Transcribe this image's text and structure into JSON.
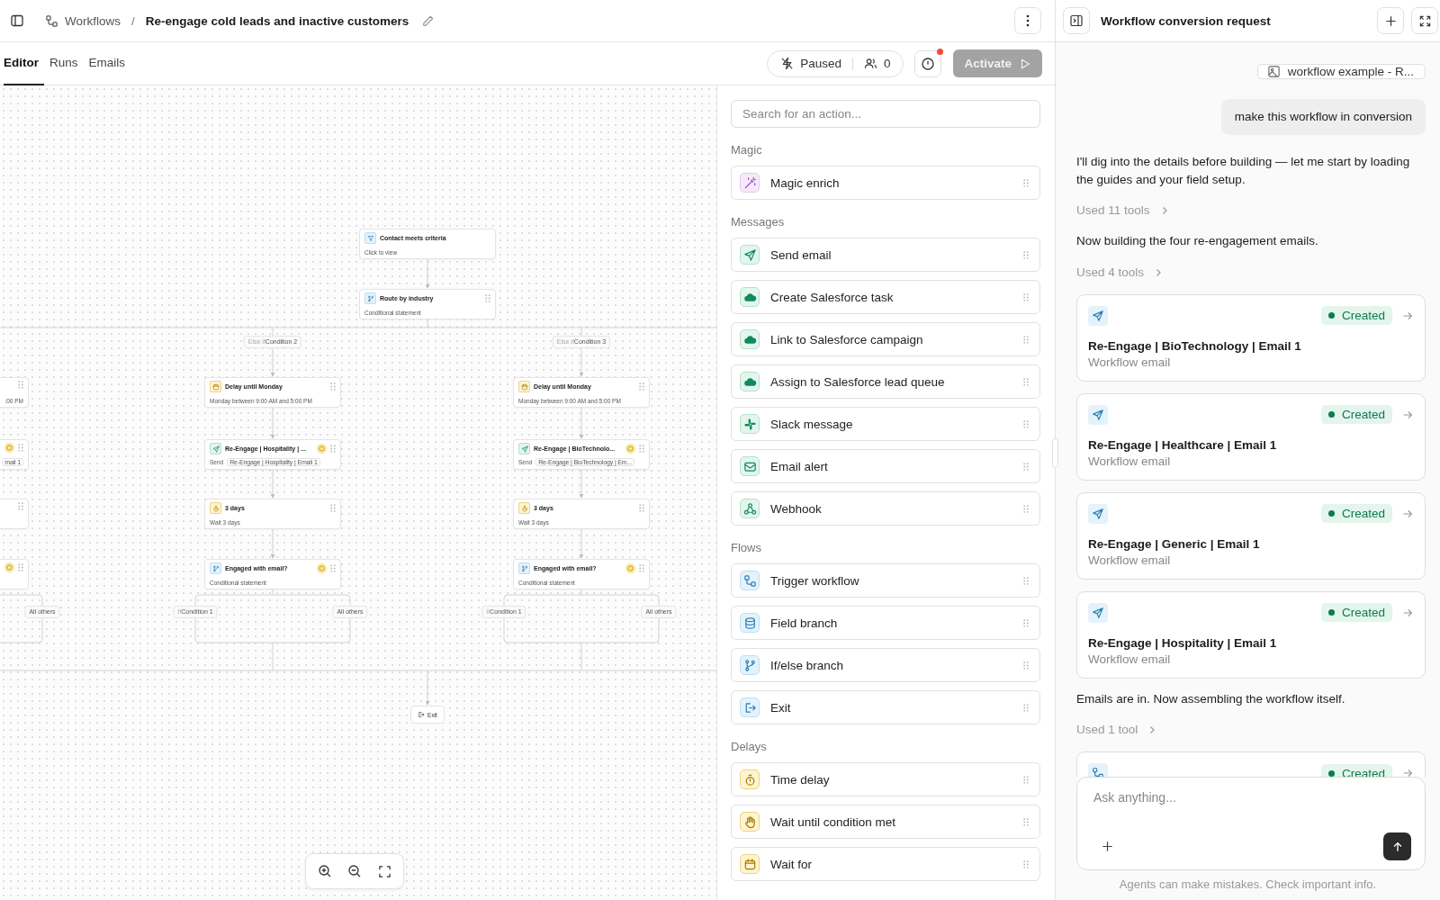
{
  "header": {
    "section": "Workflows",
    "separator": "/",
    "title": "Re-engage cold leads and inactive customers"
  },
  "tabs": [
    {
      "label": "Editor",
      "selected": true
    },
    {
      "label": "Runs",
      "selected": false
    },
    {
      "label": "Emails",
      "selected": false
    }
  ],
  "toolbar": {
    "status": "Paused",
    "enrolled": "0",
    "alert": true,
    "activate": {
      "label": "Activate",
      "disabled": true
    }
  },
  "canvas": {
    "trigger": {
      "kind": "trigger",
      "title": "Contact meets criteria",
      "subtitle": "Click to view"
    },
    "router": {
      "kind": "condition",
      "title": "Route by industry",
      "subtitle": "Conditional statement"
    },
    "cut_branch": {
      "steps": [
        {
          "subtitle": ":00 PM",
          "flagged": false
        },
        {
          "chip": "mail 1",
          "flagged": true
        },
        {
          "flagged": false
        },
        {
          "flagged": true
        }
      ],
      "outcomes": [
        {
          "label": "All others"
        }
      ]
    },
    "branches": [
      {
        "prefix": "Else if",
        "label": "Condition 2",
        "steps": [
          {
            "kind": "delay",
            "title": "Delay until Monday",
            "subtitle": "Monday between 9:00 AM and 5:00 PM",
            "flagged": false
          },
          {
            "kind": "email",
            "title": "Re-Engage | Hospitality | ...",
            "subtitle": "Send",
            "chip": "Re-Engage | Hospitality | Email 1",
            "flagged": true
          },
          {
            "kind": "wait",
            "title": "3 days",
            "subtitle": "Wait 3 days",
            "flagged": false
          },
          {
            "kind": "condition",
            "title": "Engaged with email?",
            "subtitle": "Conditional statement",
            "flagged": true
          }
        ],
        "outcomes": [
          {
            "prefix": "If",
            "label": "Condition 1"
          },
          {
            "label": "All others"
          }
        ]
      },
      {
        "prefix": "Else if",
        "label": "Condition 3",
        "steps": [
          {
            "kind": "delay",
            "title": "Delay until Monday",
            "subtitle": "Monday between 9:00 AM and 5:00 PM",
            "flagged": false
          },
          {
            "kind": "email",
            "title": "Re-Engage | BioTechnolo...",
            "subtitle": "Send",
            "chip": "Re-Engage | BioTechnology | Em...",
            "flagged": true
          },
          {
            "kind": "wait",
            "title": "3 days",
            "subtitle": "Wait 3 days",
            "flagged": false
          },
          {
            "kind": "condition",
            "title": "Engaged with email?",
            "subtitle": "Conditional statement",
            "flagged": true
          }
        ],
        "outcomes": [
          {
            "prefix": "If",
            "label": "Condition 1"
          },
          {
            "label": "All others"
          }
        ]
      }
    ],
    "exit": {
      "label": "Exit"
    }
  },
  "actions": {
    "search_placeholder": "Search for an action...",
    "sections": [
      {
        "kind": "magic",
        "title": "Magic",
        "items": [
          {
            "kind": "enrich",
            "label": "Magic enrich"
          }
        ]
      },
      {
        "kind": "messages",
        "title": "Messages",
        "items": [
          {
            "kind": "email",
            "label": "Send email"
          },
          {
            "kind": "salesforce",
            "label": "Create Salesforce task"
          },
          {
            "kind": "salesforce",
            "label": "Link to Salesforce campaign"
          },
          {
            "kind": "salesforce",
            "label": "Assign to Salesforce lead queue"
          },
          {
            "kind": "slack",
            "label": "Slack message"
          },
          {
            "kind": "alert",
            "label": "Email alert"
          },
          {
            "kind": "webhook",
            "label": "Webhook"
          }
        ]
      },
      {
        "kind": "flows",
        "title": "Flows",
        "items": [
          {
            "kind": "workflow",
            "label": "Trigger workflow"
          },
          {
            "kind": "field_branch",
            "label": "Field branch"
          },
          {
            "kind": "condition",
            "label": "If/else branch"
          },
          {
            "kind": "exit",
            "label": "Exit"
          }
        ]
      },
      {
        "kind": "delays",
        "title": "Delays",
        "items": [
          {
            "kind": "wait",
            "label": "Time delay"
          },
          {
            "kind": "wait_condition",
            "label": "Wait until condition met"
          },
          {
            "kind": "delay",
            "label": "Wait for"
          }
        ]
      }
    ]
  },
  "chat": {
    "title": "Workflow conversion request",
    "messages": [
      {
        "kind": "attachment",
        "text": "workflow example - R..."
      },
      {
        "kind": "user",
        "text": "make this workflow in conversion"
      },
      {
        "kind": "assistant",
        "text": "I'll dig into the details before building — let me start by loading the guides and your field setup."
      },
      {
        "kind": "tools",
        "text": "Used 11 tools"
      },
      {
        "kind": "assistant",
        "text": "Now building the four re-engagement emails."
      },
      {
        "kind": "tools",
        "text": "Used 4 tools"
      },
      {
        "kind": "email_card",
        "status": "Created",
        "title": "Re-Engage | BioTechnology | Email 1",
        "subtitle": "Workflow email"
      },
      {
        "kind": "email_card",
        "status": "Created",
        "title": "Re-Engage | Healthcare | Email 1",
        "subtitle": "Workflow email"
      },
      {
        "kind": "email_card",
        "status": "Created",
        "title": "Re-Engage | Generic | Email 1",
        "subtitle": "Workflow email"
      },
      {
        "kind": "email_card",
        "status": "Created",
        "title": "Re-Engage | Hospitality | Email 1",
        "subtitle": "Workflow email"
      },
      {
        "kind": "assistant",
        "text": "Emails are in. Now assembling the workflow itself."
      },
      {
        "kind": "tools",
        "text": "Used 1 tool"
      },
      {
        "kind": "workflow_card",
        "status": "Created"
      }
    ],
    "input_placeholder": "Ask anything...",
    "disclaimer": "Agents can make mistakes. Check important info."
  }
}
